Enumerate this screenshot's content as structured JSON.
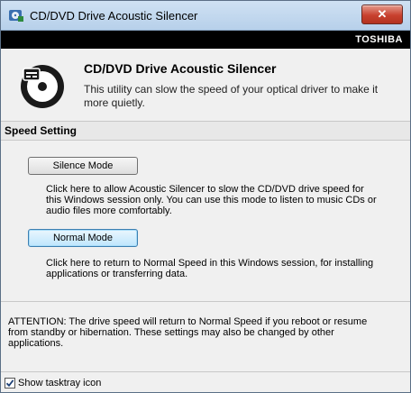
{
  "window": {
    "title": "CD/DVD Drive Acoustic Silencer"
  },
  "brand": "TOSHIBA",
  "header": {
    "title": "CD/DVD Drive Acoustic Silencer",
    "description": "This utility can slow  the speed of  your optical driver to make it more quietly."
  },
  "speed_setting": {
    "heading": "Speed Setting",
    "silence_button": "Silence Mode",
    "silence_desc": "Click here to allow Acoustic Silencer to slow the CD/DVD drive speed for this Windows session only. You can use this mode to listen to music CDs or audio files more comfortably.",
    "normal_button": "Normal Mode",
    "normal_desc": "Click here to return to Normal Speed in this Windows session, for installing applications or transferring data."
  },
  "attention": "ATTENTION: The drive speed will return to Normal Speed if you reboot or resume from standby or hibernation. These settings may also be changed by other applications.",
  "footer": {
    "checkbox_label": "Show tasktray icon",
    "checked": true
  },
  "icons": {
    "app": "disc-drive-icon",
    "close": "close-icon",
    "header": "optical-disc-icon",
    "check": "checkmark-icon"
  }
}
